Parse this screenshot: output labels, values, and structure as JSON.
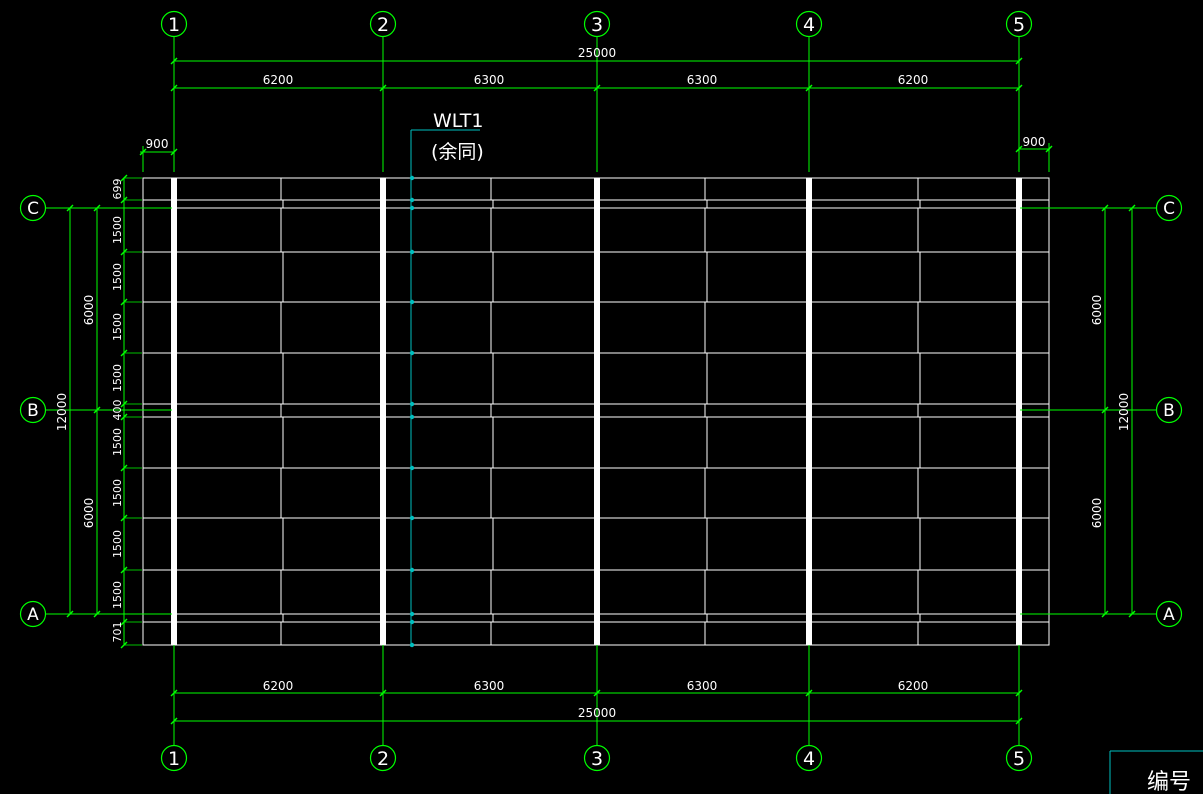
{
  "colors": {
    "background": "#000000",
    "dimension": "#00ff00",
    "panel_line": "#ffffff",
    "purlin_tag": "#00bfbf",
    "title_block": "#00bfbf"
  },
  "grid_columns": [
    {
      "label": "1"
    },
    {
      "label": "2"
    },
    {
      "label": "3"
    },
    {
      "label": "4"
    },
    {
      "label": "5"
    }
  ],
  "grid_rows": [
    {
      "label": "C"
    },
    {
      "label": "B"
    },
    {
      "label": "A"
    }
  ],
  "top_dimensions": {
    "overall": "25000",
    "spans": [
      "6200",
      "6300",
      "6300",
      "6200"
    ],
    "left_overhang": "900",
    "right_overhang": "900"
  },
  "bottom_dimensions": {
    "overall": "25000",
    "spans": [
      "6200",
      "6300",
      "6300",
      "6200"
    ]
  },
  "left_dimensions": {
    "overall": "12000",
    "bays": [
      "6000",
      "6000"
    ],
    "panels": [
      "699",
      "1500",
      "1500",
      "1500",
      "1500",
      "400",
      "1500",
      "1500",
      "1500",
      "1500",
      "701"
    ]
  },
  "right_dimensions": {
    "overall": "12000",
    "bays": [
      "6000",
      "6000"
    ]
  },
  "purlin_tag": {
    "code": "WLT1",
    "note": "(余同)"
  },
  "title_block": {
    "label": "编号"
  }
}
